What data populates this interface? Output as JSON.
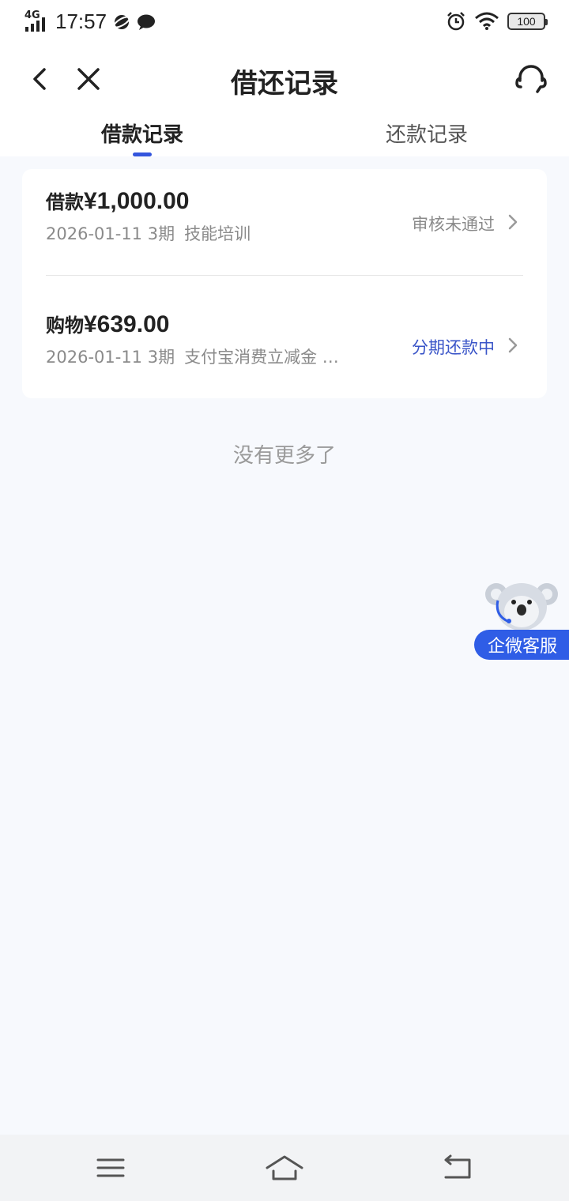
{
  "status_bar": {
    "network": "4G",
    "time": "17:57",
    "battery": "100"
  },
  "nav": {
    "title": "借还记录"
  },
  "tabs": [
    {
      "label": "借款记录",
      "active": true
    },
    {
      "label": "还款记录",
      "active": false
    }
  ],
  "records": [
    {
      "type_label": "借款",
      "amount": "¥1,000.00",
      "date": "2026-01-11",
      "periods": "3期",
      "purpose": "技能培训",
      "status": "审核未通过",
      "status_color": "#8a8a8a"
    },
    {
      "type_label": "购物",
      "amount": "¥639.00",
      "date": "2026-01-11",
      "periods": "3期",
      "purpose": "支付宝消费立减金 …",
      "status": "分期还款中",
      "status_color": "#3a55c8"
    }
  ],
  "footer_text": "没有更多了",
  "customer_service": {
    "label": "企微客服",
    "color": "#2f5de6"
  },
  "icons": {
    "back": "chevron-left-icon",
    "close": "close-icon",
    "service": "headset-icon",
    "menu": "menu-icon",
    "home": "home-icon",
    "return": "return-icon"
  }
}
